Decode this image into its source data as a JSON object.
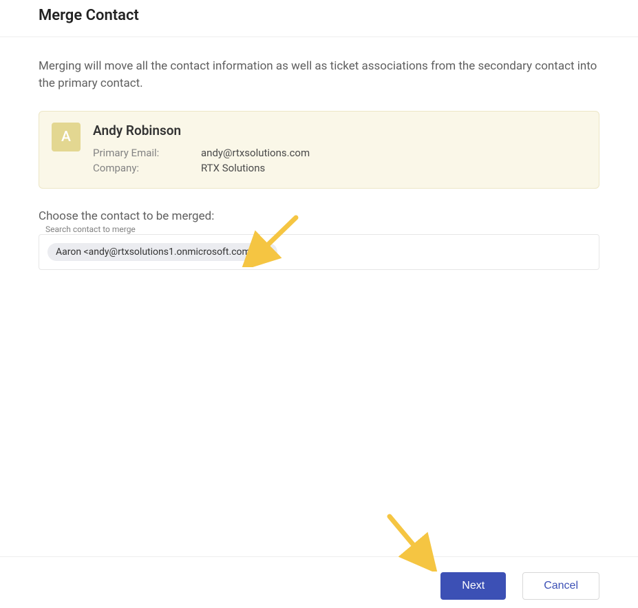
{
  "header": {
    "title": "Merge Contact"
  },
  "description": "Merging will move all the contact information as well as ticket associations from the secondary contact into the primary contact.",
  "primary_contact": {
    "avatar_initial": "A",
    "name": "Andy Robinson",
    "email_label": "Primary Email:",
    "email_value": "andy@rtxsolutions.com",
    "company_label": "Company:",
    "company_value": "RTX Solutions"
  },
  "choose_section": {
    "label": "Choose the contact to be merged:",
    "search_label": "Search contact to merge",
    "chip_text": "Aaron <andy@rtxsolutions1.onmicrosoft.com>"
  },
  "footer": {
    "next_label": "Next",
    "cancel_label": "Cancel"
  }
}
